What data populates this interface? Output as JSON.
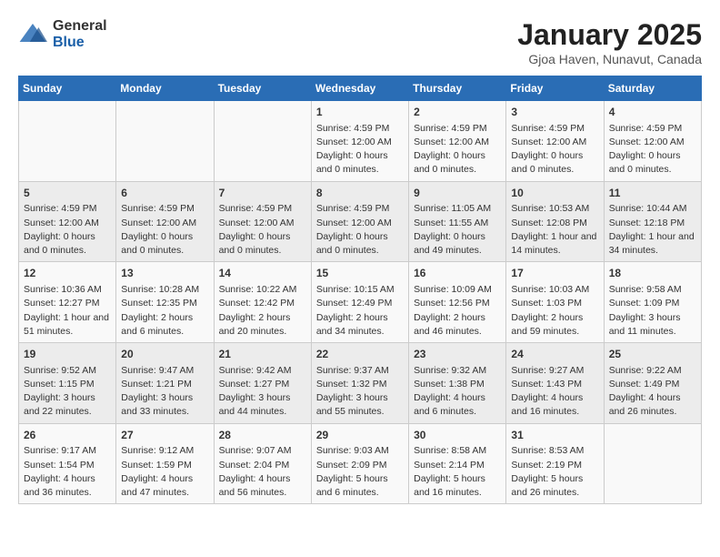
{
  "header": {
    "logo_general": "General",
    "logo_blue": "Blue",
    "title": "January 2025",
    "subtitle": "Gjoa Haven, Nunavut, Canada"
  },
  "calendar": {
    "days_of_week": [
      "Sunday",
      "Monday",
      "Tuesday",
      "Wednesday",
      "Thursday",
      "Friday",
      "Saturday"
    ],
    "weeks": [
      [
        {
          "day": "",
          "info": ""
        },
        {
          "day": "",
          "info": ""
        },
        {
          "day": "",
          "info": ""
        },
        {
          "day": "1",
          "info": "Sunrise: 4:59 PM\nSunset: 12:00 AM\nDaylight: 0 hours and 0 minutes."
        },
        {
          "day": "2",
          "info": "Sunrise: 4:59 PM\nSunset: 12:00 AM\nDaylight: 0 hours and 0 minutes."
        },
        {
          "day": "3",
          "info": "Sunrise: 4:59 PM\nSunset: 12:00 AM\nDaylight: 0 hours and 0 minutes."
        },
        {
          "day": "4",
          "info": "Sunrise: 4:59 PM\nSunset: 12:00 AM\nDaylight: 0 hours and 0 minutes."
        }
      ],
      [
        {
          "day": "5",
          "info": "Sunrise: 4:59 PM\nSunset: 12:00 AM\nDaylight: 0 hours and 0 minutes."
        },
        {
          "day": "6",
          "info": "Sunrise: 4:59 PM\nSunset: 12:00 AM\nDaylight: 0 hours and 0 minutes."
        },
        {
          "day": "7",
          "info": "Sunrise: 4:59 PM\nSunset: 12:00 AM\nDaylight: 0 hours and 0 minutes."
        },
        {
          "day": "8",
          "info": "Sunrise: 4:59 PM\nSunset: 12:00 AM\nDaylight: 0 hours and 0 minutes."
        },
        {
          "day": "9",
          "info": "Sunrise: 11:05 AM\nSunset: 11:55 AM\nDaylight: 0 hours and 49 minutes."
        },
        {
          "day": "10",
          "info": "Sunrise: 10:53 AM\nSunset: 12:08 PM\nDaylight: 1 hour and 14 minutes."
        },
        {
          "day": "11",
          "info": "Sunrise: 10:44 AM\nSunset: 12:18 PM\nDaylight: 1 hour and 34 minutes."
        }
      ],
      [
        {
          "day": "12",
          "info": "Sunrise: 10:36 AM\nSunset: 12:27 PM\nDaylight: 1 hour and 51 minutes."
        },
        {
          "day": "13",
          "info": "Sunrise: 10:28 AM\nSunset: 12:35 PM\nDaylight: 2 hours and 6 minutes."
        },
        {
          "day": "14",
          "info": "Sunrise: 10:22 AM\nSunset: 12:42 PM\nDaylight: 2 hours and 20 minutes."
        },
        {
          "day": "15",
          "info": "Sunrise: 10:15 AM\nSunset: 12:49 PM\nDaylight: 2 hours and 34 minutes."
        },
        {
          "day": "16",
          "info": "Sunrise: 10:09 AM\nSunset: 12:56 PM\nDaylight: 2 hours and 46 minutes."
        },
        {
          "day": "17",
          "info": "Sunrise: 10:03 AM\nSunset: 1:03 PM\nDaylight: 2 hours and 59 minutes."
        },
        {
          "day": "18",
          "info": "Sunrise: 9:58 AM\nSunset: 1:09 PM\nDaylight: 3 hours and 11 minutes."
        }
      ],
      [
        {
          "day": "19",
          "info": "Sunrise: 9:52 AM\nSunset: 1:15 PM\nDaylight: 3 hours and 22 minutes."
        },
        {
          "day": "20",
          "info": "Sunrise: 9:47 AM\nSunset: 1:21 PM\nDaylight: 3 hours and 33 minutes."
        },
        {
          "day": "21",
          "info": "Sunrise: 9:42 AM\nSunset: 1:27 PM\nDaylight: 3 hours and 44 minutes."
        },
        {
          "day": "22",
          "info": "Sunrise: 9:37 AM\nSunset: 1:32 PM\nDaylight: 3 hours and 55 minutes."
        },
        {
          "day": "23",
          "info": "Sunrise: 9:32 AM\nSunset: 1:38 PM\nDaylight: 4 hours and 6 minutes."
        },
        {
          "day": "24",
          "info": "Sunrise: 9:27 AM\nSunset: 1:43 PM\nDaylight: 4 hours and 16 minutes."
        },
        {
          "day": "25",
          "info": "Sunrise: 9:22 AM\nSunset: 1:49 PM\nDaylight: 4 hours and 26 minutes."
        }
      ],
      [
        {
          "day": "26",
          "info": "Sunrise: 9:17 AM\nSunset: 1:54 PM\nDaylight: 4 hours and 36 minutes."
        },
        {
          "day": "27",
          "info": "Sunrise: 9:12 AM\nSunset: 1:59 PM\nDaylight: 4 hours and 47 minutes."
        },
        {
          "day": "28",
          "info": "Sunrise: 9:07 AM\nSunset: 2:04 PM\nDaylight: 4 hours and 56 minutes."
        },
        {
          "day": "29",
          "info": "Sunrise: 9:03 AM\nSunset: 2:09 PM\nDaylight: 5 hours and 6 minutes."
        },
        {
          "day": "30",
          "info": "Sunrise: 8:58 AM\nSunset: 2:14 PM\nDaylight: 5 hours and 16 minutes."
        },
        {
          "day": "31",
          "info": "Sunrise: 8:53 AM\nSunset: 2:19 PM\nDaylight: 5 hours and 26 minutes."
        },
        {
          "day": "",
          "info": ""
        }
      ]
    ]
  }
}
